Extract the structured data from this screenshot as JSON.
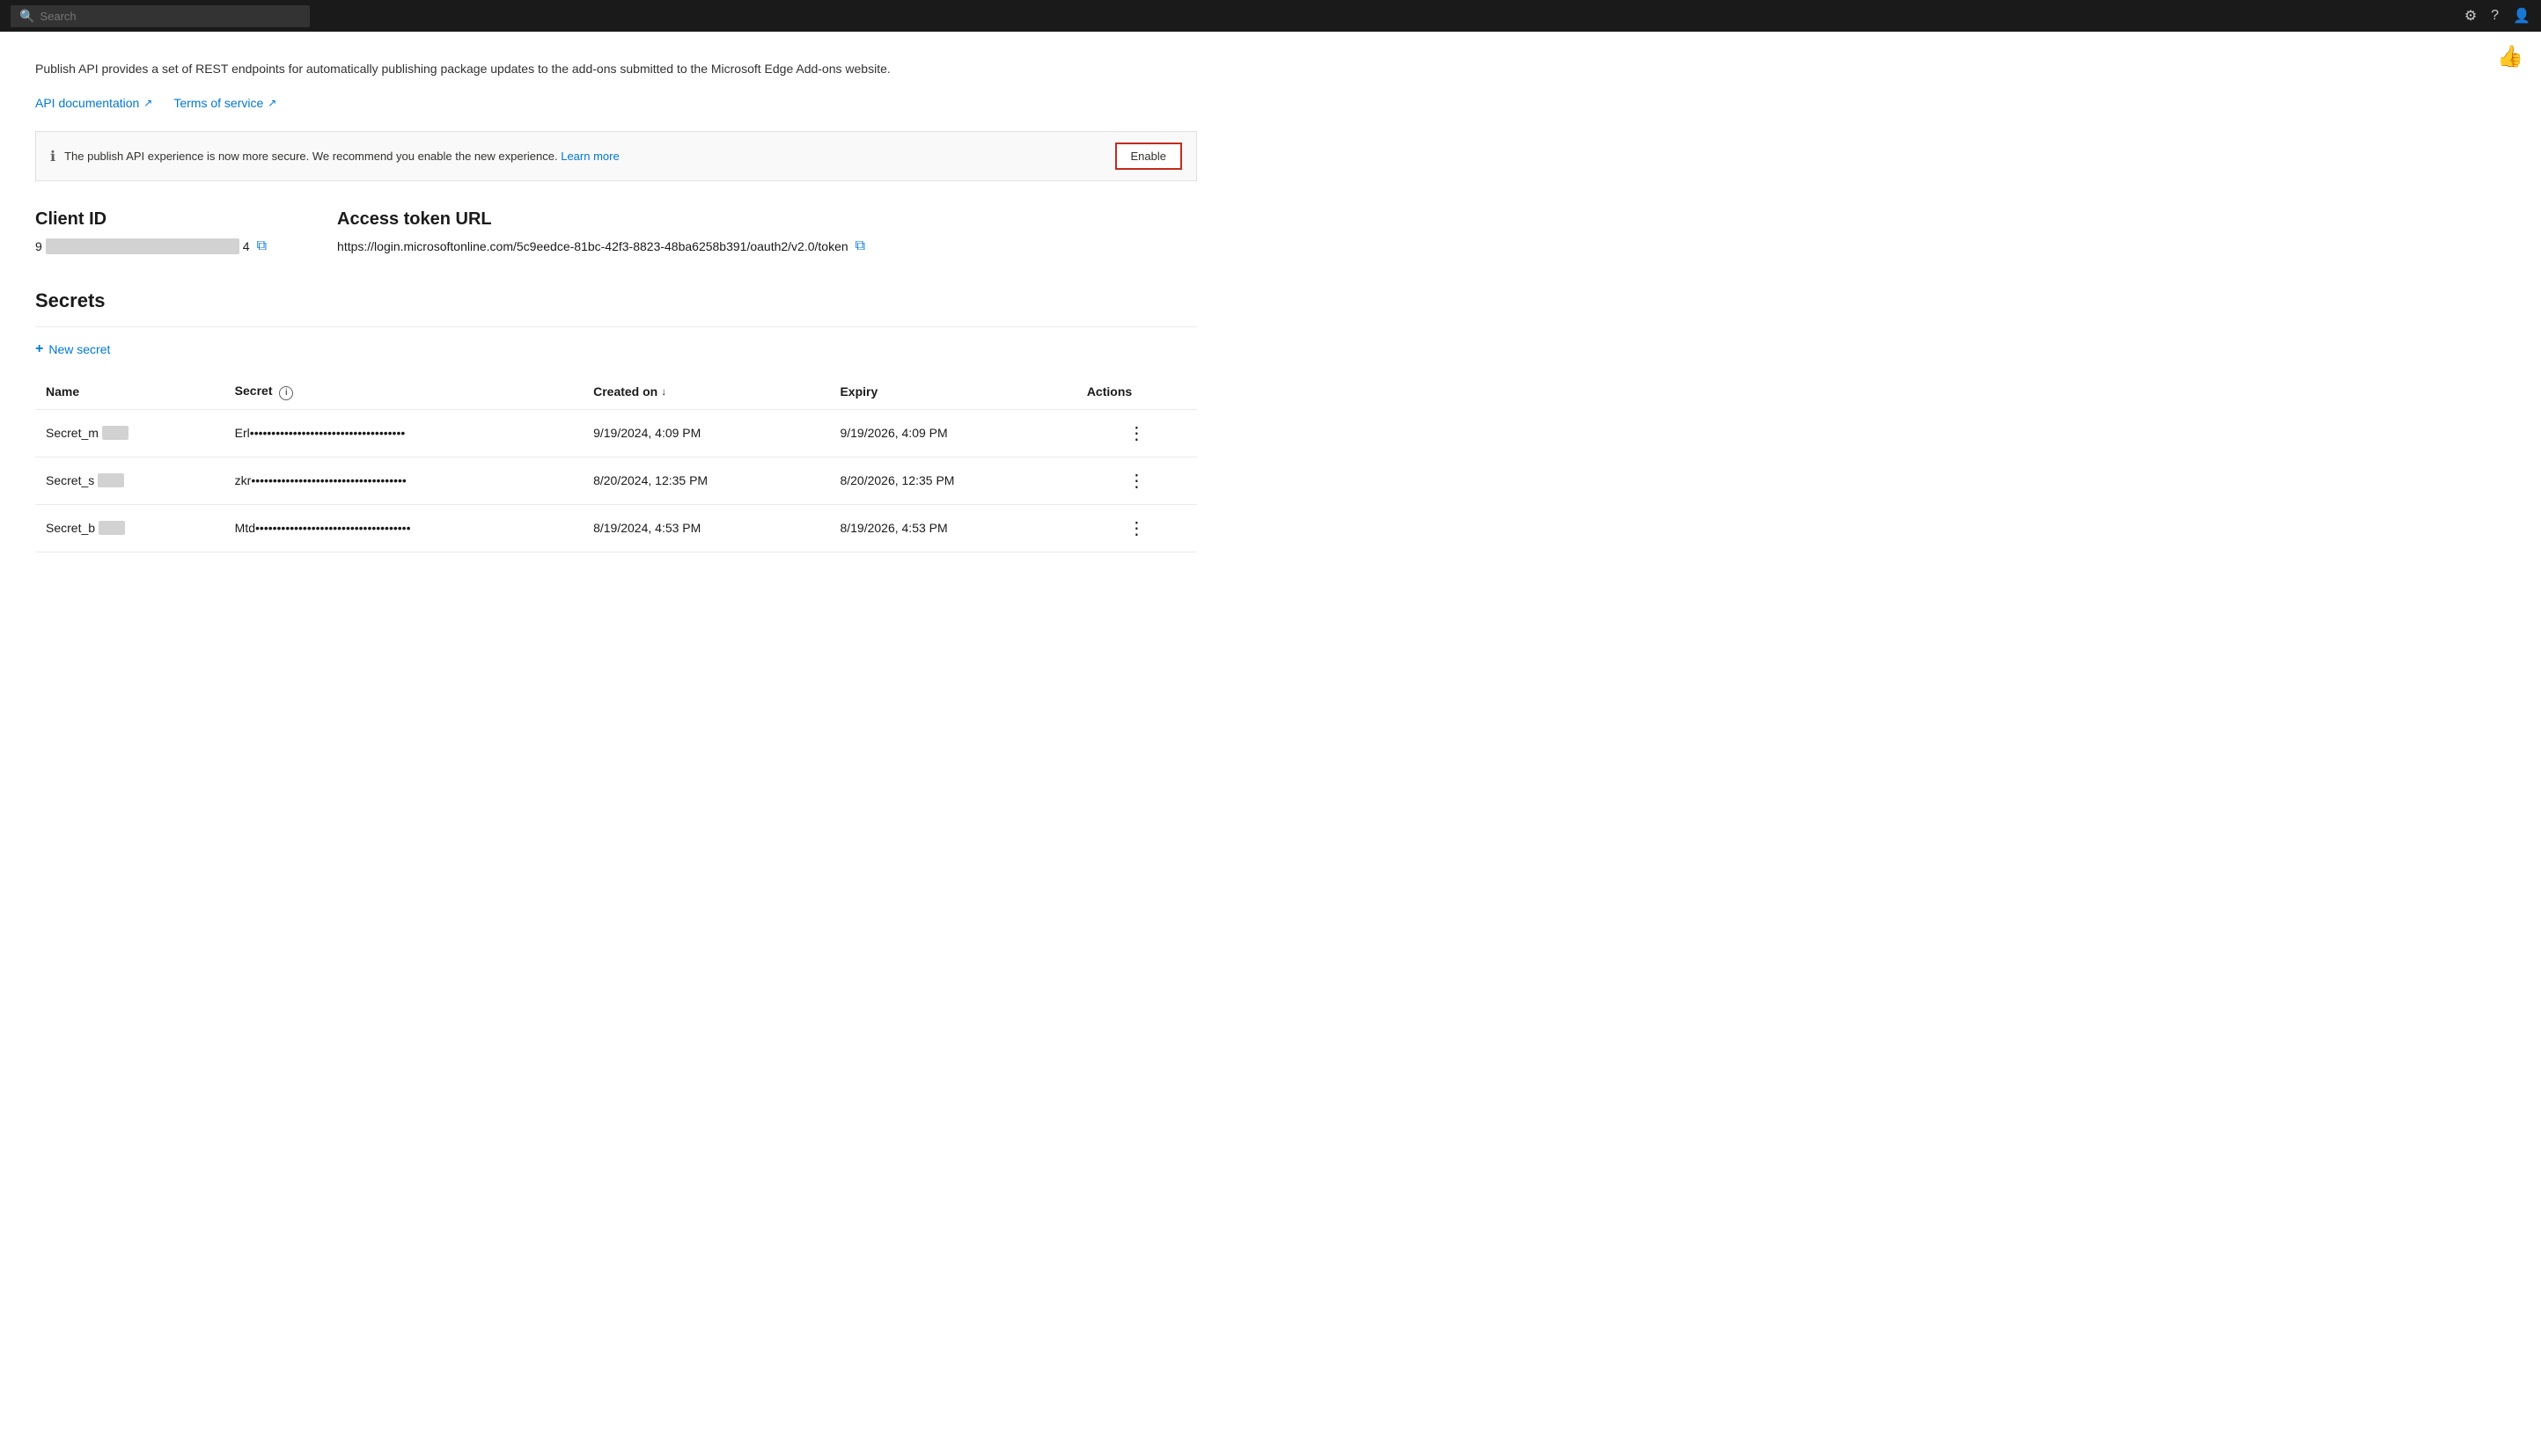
{
  "topbar": {
    "search_placeholder": "Search",
    "icons": [
      "settings-icon",
      "help-icon",
      "account-icon"
    ]
  },
  "feedback": {
    "icon": "👍"
  },
  "description": {
    "text": "Publish API provides a set of REST endpoints for automatically publishing package updates to the add-ons submitted to the Microsoft Edge Add-ons website."
  },
  "links": [
    {
      "label": "API documentation",
      "id": "api-docs-link"
    },
    {
      "label": "Terms of service",
      "id": "terms-link"
    }
  ],
  "banner": {
    "message": "The publish API experience is now more secure. We recommend you enable the new experience.",
    "learn_more": "Learn more",
    "button_label": "Enable"
  },
  "client_id": {
    "label": "Client ID",
    "prefix": "9",
    "suffix": "4"
  },
  "access_token": {
    "label": "Access token URL",
    "value": "https://login.microsoftonline.com/5c9eedce-81bc-42f3-8823-48ba6258b391/oauth2/v2.0/token"
  },
  "secrets": {
    "title": "Secrets",
    "new_secret_label": "New secret",
    "columns": {
      "name": "Name",
      "secret": "Secret",
      "created_on": "Created on",
      "expiry": "Expiry",
      "actions": "Actions"
    },
    "rows": [
      {
        "name_prefix": "Secret_m",
        "secret_prefix": "Erl",
        "secret_dots": "••••••••••••••••••••••••••••••••••••",
        "created_on": "9/19/2024, 4:09 PM",
        "expiry": "9/19/2026, 4:09 PM"
      },
      {
        "name_prefix": "Secret_s",
        "secret_prefix": "zkr",
        "secret_dots": "••••••••••••••••••••••••••••••••••••",
        "created_on": "8/20/2024, 12:35 PM",
        "expiry": "8/20/2026, 12:35 PM"
      },
      {
        "name_prefix": "Secret_b",
        "secret_prefix": "Mtd",
        "secret_dots": "••••••••••••••••••••••••••••••••••••",
        "created_on": "8/19/2024, 4:53 PM",
        "expiry": "8/19/2026, 4:53 PM"
      }
    ]
  }
}
